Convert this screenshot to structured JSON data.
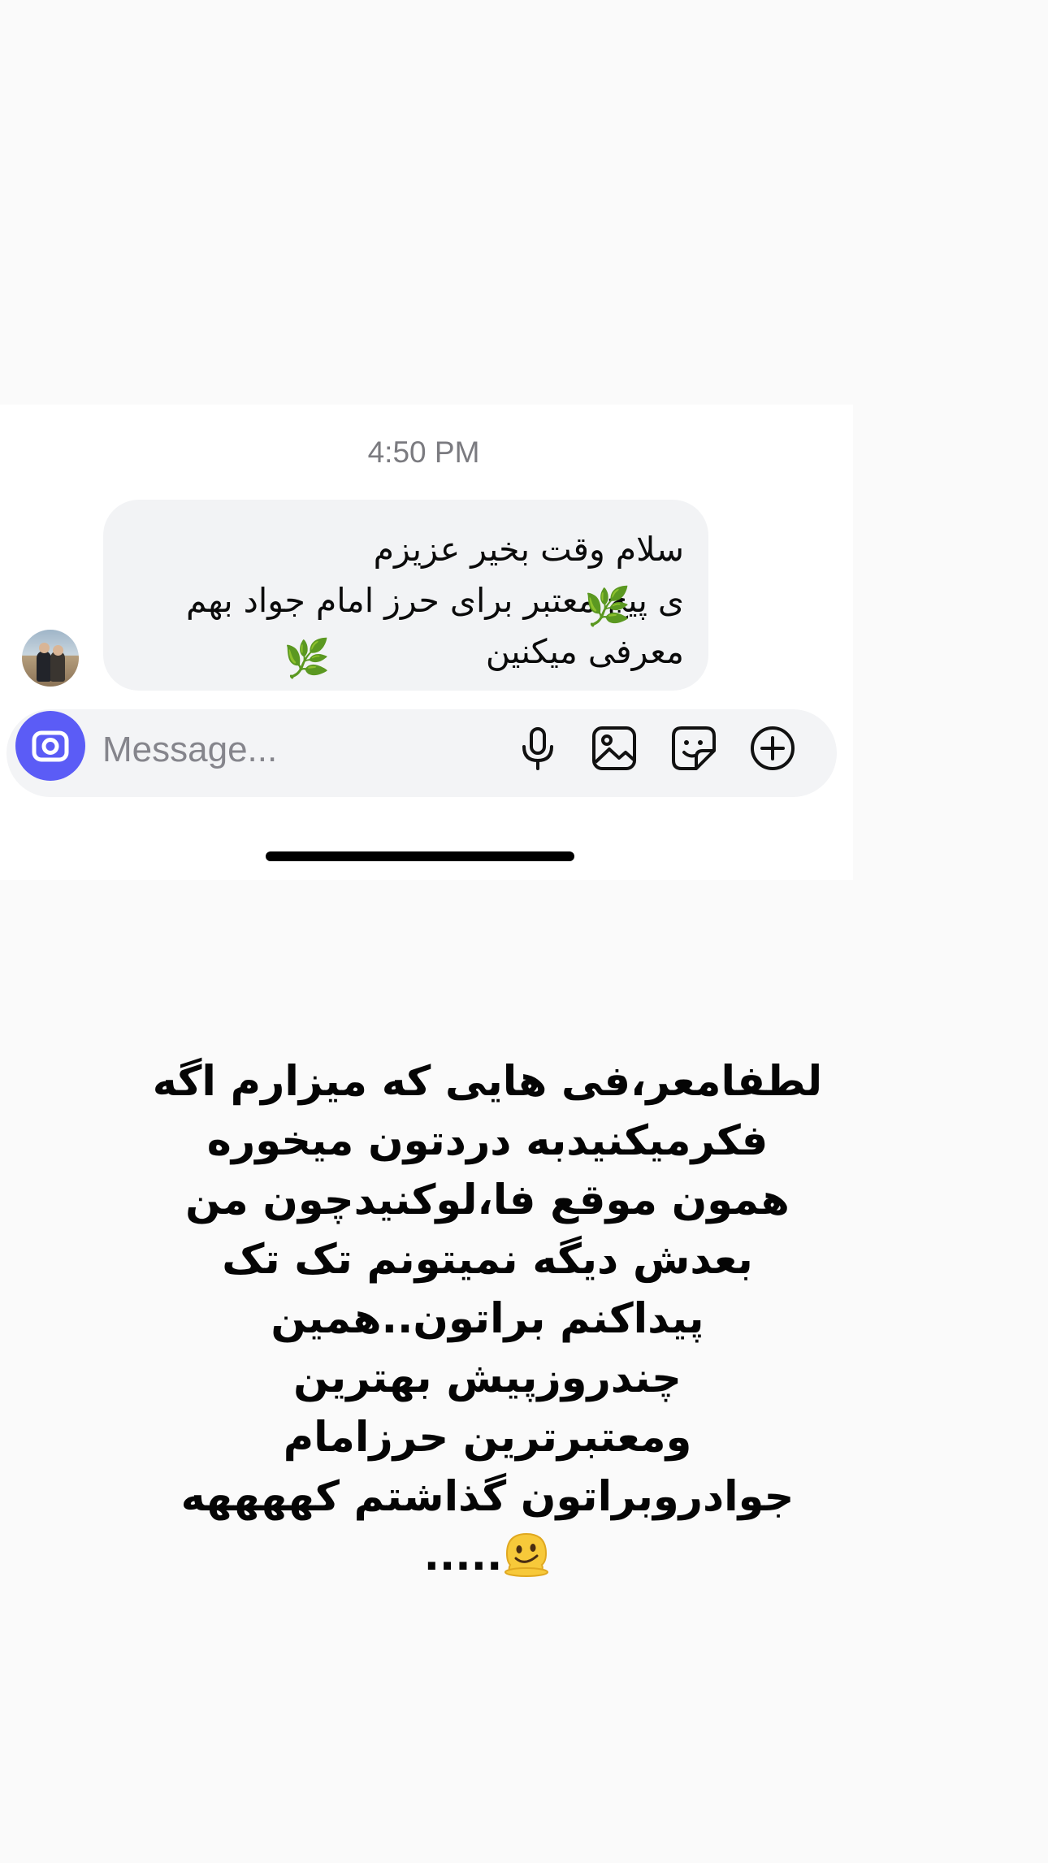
{
  "chat": {
    "timestamp": "4:50 PM",
    "message": {
      "lines": [
        "سلام وقت بخیر عزیزم",
        "ی پیج معتبر برای حرز امام جواد بهم",
        "معرفی میکنین"
      ],
      "decoration_icon": "leaf-emoji-icon"
    },
    "avatar_icon": "profile-avatar"
  },
  "composer": {
    "placeholder": "Message...",
    "icons": [
      "camera-icon",
      "microphone-icon",
      "image-icon",
      "sticker-icon",
      "plus-circle-icon"
    ],
    "accent_color": "#5b5cf6"
  },
  "caption": {
    "lines": [
      "لطفامعر،فی هایی که میزارم اگه",
      "فکرمیکنیدبه دردتون میخوره",
      "همون موقع فا،لوکنیدچون من",
      "بعدش دیگه نمیتونم تک تک",
      "پیداکنم براتون..همین",
      "چندروزپیش بهترین",
      "ومعتبرترین حرزامام",
      "جوادروبراتون گذاشتم کههههه"
    ],
    "last_line_text": ".....",
    "emoji_icon": "melting-face-emoji"
  }
}
